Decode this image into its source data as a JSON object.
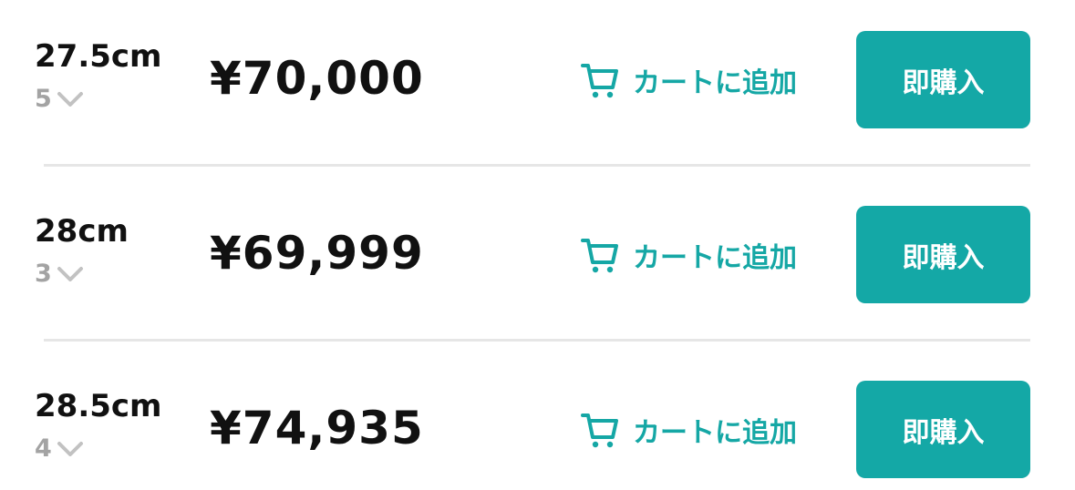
{
  "rows": [
    {
      "size": "27.5cm",
      "count": "5",
      "price": "¥70,000",
      "cart_label": "カートに追加",
      "buy_label": "即購入"
    },
    {
      "size": "28cm",
      "count": "3",
      "price": "¥69,999",
      "cart_label": "カートに追加",
      "buy_label": "即購入"
    },
    {
      "size": "28.5cm",
      "count": "4",
      "price": "¥74,935",
      "cart_label": "カートに追加",
      "buy_label": "即購入"
    }
  ],
  "icons": {
    "cart": "cart-icon",
    "chevron": "chevron-down-icon"
  },
  "colors": {
    "accent": "#14a8a6",
    "count_gray": "#a3a3a3",
    "divider": "#e6e6e6"
  }
}
